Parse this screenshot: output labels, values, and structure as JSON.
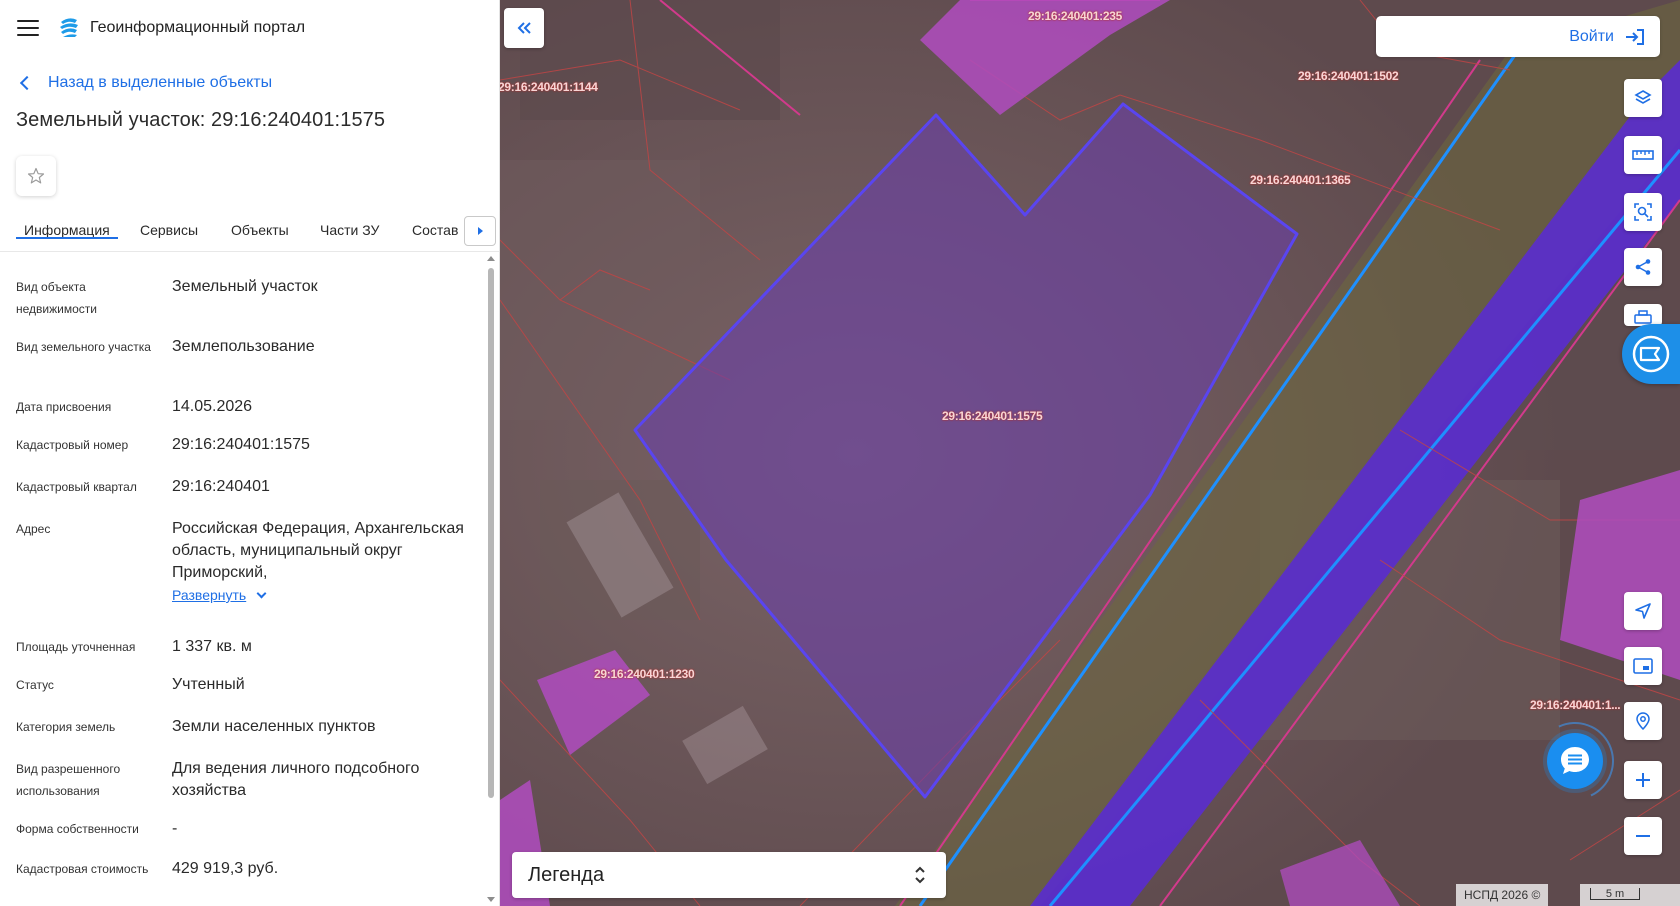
{
  "header": {
    "app_title": "Геоинформационный портал"
  },
  "nav": {
    "back_label": "Назад в выделенные объекты"
  },
  "object": {
    "title": "Земельный участок: 29:16:240401:1575"
  },
  "tabs": [
    {
      "label": "Информация",
      "active": true
    },
    {
      "label": "Сервисы",
      "active": false
    },
    {
      "label": "Объекты",
      "active": false
    },
    {
      "label": "Части ЗУ",
      "active": false
    },
    {
      "label": "Состав",
      "active": false
    }
  ],
  "properties": [
    {
      "key": "Вид объекта недвижимости",
      "value": "Земельный участок"
    },
    {
      "key": "Вид земельного участка",
      "value": "Землепользование"
    },
    {
      "key": "Дата присвоения",
      "value": "14.05.2026"
    },
    {
      "key": "Кадастровый номер",
      "value": "29:16:240401:1575"
    },
    {
      "key": "Кадастровый квартал",
      "value": "29:16:240401"
    },
    {
      "key": "Адрес",
      "value": "Российская Федерация, Архангельская область, муниципальный округ Приморский,"
    },
    {
      "key": "Площадь уточненная",
      "value": "1 337 кв. м"
    },
    {
      "key": "Статус",
      "value": "Учтенный"
    },
    {
      "key": "Категория земель",
      "value": "Земли населенных пунктов"
    },
    {
      "key": "Вид разрешенного использования",
      "value": "Для ведения личного подсобного хозяйства"
    },
    {
      "key": "Форма собственности",
      "value": "-"
    },
    {
      "key": "Кадастровая стоимость",
      "value": "429 919,3 руб."
    }
  ],
  "address_expand_label": "Развернуть",
  "map": {
    "login_label": "Войти",
    "legend_label": "Легенда",
    "attribution": "НСПД 2026 ©",
    "scale_label": "5 m",
    "parcel_labels": [
      "29:16:240401:235",
      "29:16:240401:1144",
      "29:16:240401:1502",
      "29:16:240401:1365",
      "29:16:240401:1575",
      "29:16:240401:1230",
      "29:16:240401:1..."
    ]
  },
  "colors": {
    "accent": "#1f6fe5",
    "selected_parcel_fill": "#6a3fa8",
    "parcel_border": "#e0348a",
    "road_fill": "#5a2ccf",
    "road_line": "#1e90ff"
  }
}
